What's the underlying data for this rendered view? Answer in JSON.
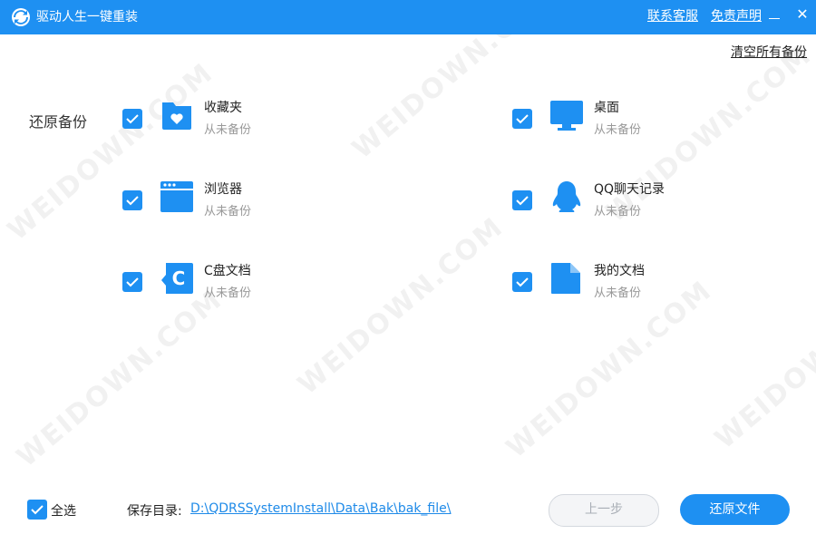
{
  "window": {
    "title": "驱动人生一键重装",
    "contact_link": "联系客服",
    "disclaimer_link": "免责声明",
    "close_glyph": "✕"
  },
  "clear_all": "清空所有备份",
  "section_label": "还原备份",
  "items": [
    {
      "name": "收藏夹",
      "status": "从未备份",
      "checked": true,
      "icon": "favorites-folder-icon"
    },
    {
      "name": "桌面",
      "status": "从未备份",
      "checked": true,
      "icon": "desktop-monitor-icon"
    },
    {
      "name": "浏览器",
      "status": "从未备份",
      "checked": true,
      "icon": "browser-window-icon"
    },
    {
      "name": "QQ聊天记录",
      "status": "从未备份",
      "checked": true,
      "icon": "qq-penguin-icon"
    },
    {
      "name": "C盘文档",
      "status": "从未备份",
      "checked": true,
      "icon": "c-drive-icon"
    },
    {
      "name": "我的文档",
      "status": "从未备份",
      "checked": true,
      "icon": "document-icon"
    }
  ],
  "footer": {
    "select_all": "全选",
    "select_all_checked": true,
    "save_label": "保存目录:",
    "save_path": "D:\\QDRSSystemInstall\\Data\\Bak\\bak_file\\",
    "prev_button": "上一步",
    "restore_button": "还原文件"
  },
  "watermark": "WEIDOWN.COM",
  "colors": {
    "accent": "#1e90f2",
    "link": "#1e8ae8",
    "muted_text": "#999999"
  }
}
